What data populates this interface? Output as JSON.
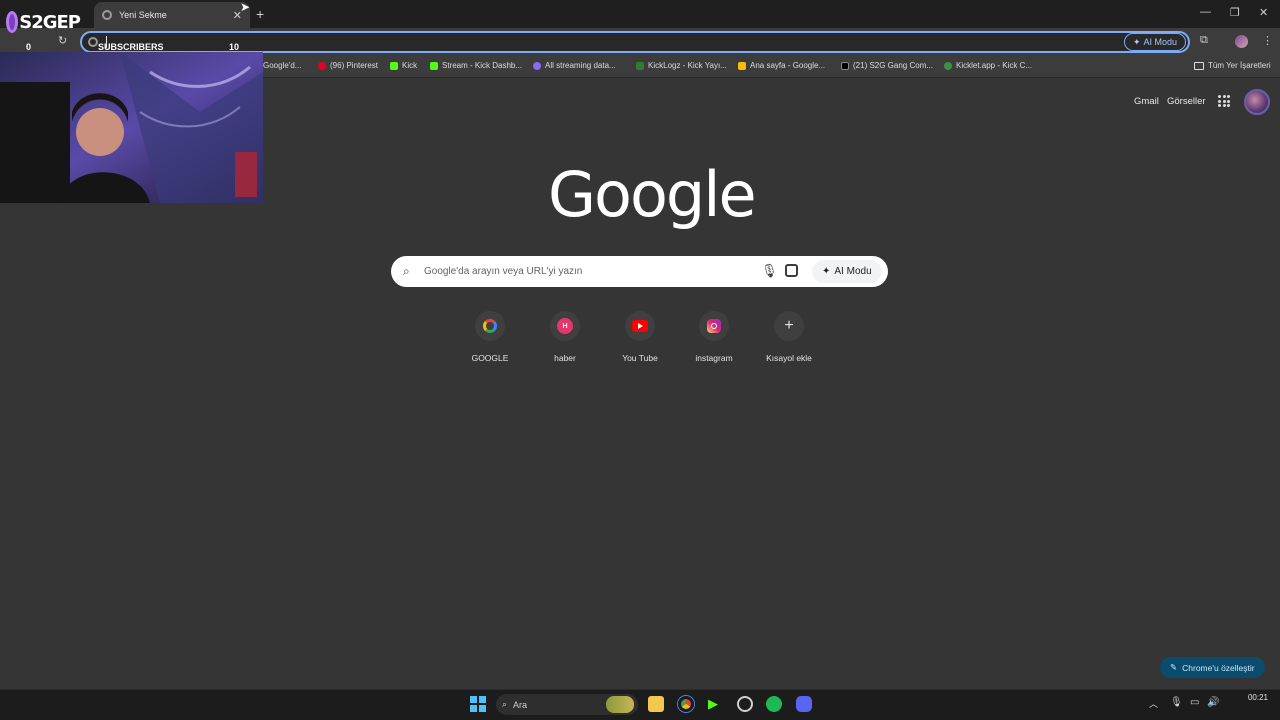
{
  "tab": {
    "title": "Yeni Sekme"
  },
  "overlay": {
    "logo": "S2GEP",
    "subscribers_label": "SUBSCRIBERS",
    "count_left": "0",
    "count_right": "10"
  },
  "toolbar": {
    "ai_mode": "AI Modu"
  },
  "bookmarks": {
    "items": [
      {
        "label": "Google'd...",
        "icon": "google-icon",
        "color": "#4285f4"
      },
      {
        "label": "(96) Pinterest",
        "icon": "pinterest-icon",
        "color": "#e60023"
      },
      {
        "label": "Kick",
        "icon": "kick-icon",
        "color": "#53fc18"
      },
      {
        "label": "Stream - Kick Dashb...",
        "icon": "kick-icon",
        "color": "#53fc18"
      },
      {
        "label": "All streaming data...",
        "icon": "streaming-icon",
        "color": "#8a6cf0"
      },
      {
        "label": "KickLogz - Kick Yayı...",
        "icon": "kicklogz-icon",
        "color": "#2e7d32"
      },
      {
        "label": "Ana sayfa - Google...",
        "icon": "drive-icon",
        "color": "#fbbc05"
      },
      {
        "label": "(21) S2G Gang Com...",
        "icon": "x-icon",
        "color": "#000000"
      },
      {
        "label": "Kicklet.app - Kick C...",
        "icon": "kicklet-icon",
        "color": "#3f9142"
      }
    ],
    "all_bookmarks": "Tüm Yer İşaretleri"
  },
  "header": {
    "gmail": "Gmail",
    "images": "Görseller"
  },
  "logo": {
    "text": "Google"
  },
  "search": {
    "placeholder": "Google'da arayın veya URL'yi yazın",
    "ai_mode": "AI Modu"
  },
  "shortcuts": [
    {
      "label": "GOOGLE",
      "icon": "google-icon"
    },
    {
      "label": "haber",
      "icon": "haber-icon",
      "letter": "H"
    },
    {
      "label": "You Tube",
      "icon": "youtube-icon"
    },
    {
      "label": "instagram",
      "icon": "instagram-icon"
    },
    {
      "label": "Kısayol ekle",
      "icon": "plus-icon"
    }
  ],
  "customize": {
    "label": "Chrome'u özelleştir"
  },
  "taskbar": {
    "search": "Ara",
    "time": "00:21",
    "accent": "#4cc2ff"
  }
}
